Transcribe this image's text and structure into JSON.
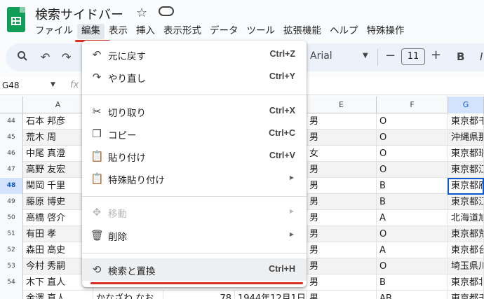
{
  "app": {
    "doc_title": "検索サイドバー",
    "menus": [
      "ファイル",
      "編集",
      "表示",
      "挿入",
      "表示形式",
      "データ",
      "ツール",
      "拡張機能",
      "ヘルプ",
      "特殊操作"
    ],
    "active_menu": "編集"
  },
  "toolbar": {
    "font_name": "Arial",
    "font_size": "11",
    "bold_label": "B",
    "italic_label": "I"
  },
  "formula_bar": {
    "cell_ref": "G48",
    "fx": "fx"
  },
  "grid": {
    "column_headers": {
      "a": "A",
      "e": "E",
      "f": "F",
      "g": "G"
    },
    "rows": [
      {
        "num": "44",
        "name": "石本 邦彦",
        "e": "男",
        "f": "O",
        "g": "東京都千"
      },
      {
        "num": "45",
        "name": "荒木 周",
        "e": "男",
        "f": "O",
        "g": "沖縄県那"
      },
      {
        "num": "46",
        "name": "中尾 真澄",
        "e": "女",
        "f": "O",
        "g": "東京都瑞"
      },
      {
        "num": "47",
        "name": "高野 友宏",
        "e": "男",
        "f": "O",
        "g": "東京都江"
      },
      {
        "num": "48",
        "name": "関岡 千里",
        "e": "男",
        "f": "B",
        "g": "東京都府"
      },
      {
        "num": "49",
        "name": "藤原 博史",
        "e": "男",
        "f": "B",
        "g": "東京都江"
      },
      {
        "num": "50",
        "name": "高橋 啓介",
        "e": "男",
        "f": "A",
        "g": "北海道旭"
      },
      {
        "num": "51",
        "name": "有田 孝",
        "e": "男",
        "f": "O",
        "g": "東京都荒"
      },
      {
        "num": "52",
        "name": "森田 高史",
        "e": "男",
        "f": "A",
        "g": "東京都台"
      },
      {
        "num": "53",
        "name": "今村 秀嗣",
        "e": "男",
        "f": "O",
        "g": "埼玉県川"
      },
      {
        "num": "54",
        "name": "木下 直人",
        "e": "男",
        "f": "B",
        "g": "東京都北"
      },
      {
        "num": "55",
        "name": "金澤 直人",
        "e": "男",
        "f": "AB",
        "g": "東京都千"
      }
    ],
    "partial_row": {
      "furigana": "かなざわ なお",
      "age": "78",
      "birth": "1944年12月1日"
    },
    "selected_row": "48"
  },
  "edit_menu": {
    "items": [
      {
        "icon": "undo-icon",
        "label": "元に戻す",
        "shortcut": "Ctrl+Z"
      },
      {
        "icon": "redo-icon",
        "label": "やり直し",
        "shortcut": "Ctrl+Y"
      },
      {
        "icon": "cut-icon",
        "label": "切り取り",
        "shortcut": "Ctrl+X"
      },
      {
        "icon": "copy-icon",
        "label": "コピー",
        "shortcut": "Ctrl+C"
      },
      {
        "icon": "paste-icon",
        "label": "貼り付け",
        "shortcut": "Ctrl+V"
      },
      {
        "icon": "paste-special-icon",
        "label": "特殊貼り付け",
        "shortcut": ""
      },
      {
        "icon": "move-icon",
        "label": "移動",
        "shortcut": ""
      },
      {
        "icon": "delete-icon",
        "label": "削除",
        "shortcut": ""
      },
      {
        "icon": "find-replace-icon",
        "label": "検索と置換",
        "shortcut": "Ctrl+H"
      }
    ]
  },
  "colors": {
    "accent_red": "#d93025",
    "sheets_green": "#0f9d58",
    "selection_blue": "#0b57d0"
  }
}
